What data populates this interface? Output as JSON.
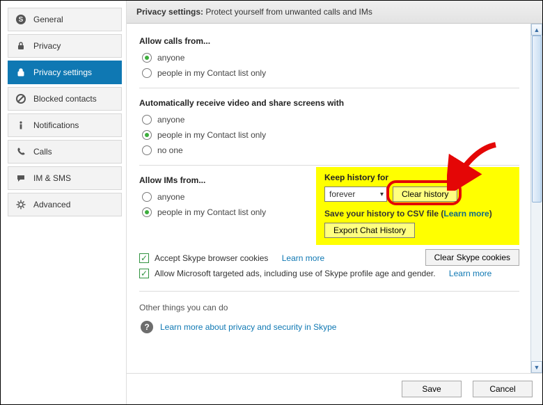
{
  "header": {
    "title_bold": "Privacy settings:",
    "title_rest": "Protect yourself from unwanted calls and IMs"
  },
  "sidebar": {
    "items": [
      {
        "label": "General"
      },
      {
        "label": "Privacy"
      },
      {
        "label": "Privacy settings"
      },
      {
        "label": "Blocked contacts"
      },
      {
        "label": "Notifications"
      },
      {
        "label": "Calls"
      },
      {
        "label": "IM & SMS"
      },
      {
        "label": "Advanced"
      }
    ]
  },
  "sections": {
    "calls": {
      "title": "Allow calls from...",
      "options": [
        "anyone",
        "people in my Contact list only"
      ],
      "selected": 0
    },
    "video": {
      "title": "Automatically receive video and share screens with",
      "options": [
        "anyone",
        "people in my Contact list only",
        "no one"
      ],
      "selected": 1
    },
    "ims": {
      "title": "Allow IMs from...",
      "options": [
        "anyone",
        "people in my Contact list only"
      ],
      "selected": 1
    }
  },
  "history": {
    "keep_title": "Keep history for",
    "select_value": "forever",
    "clear_btn": "Clear history",
    "save_text": "Save your history to CSV file (",
    "learn_more": "Learn more",
    "save_text_end": ")",
    "export_btn": "Export Chat History"
  },
  "checkboxes": {
    "cookies_text": "Accept Skype browser cookies",
    "cookies_learn": "Learn more",
    "ads_text": "Allow Microsoft targeted ads, including use of Skype profile age and gender.",
    "ads_learn": "Learn more"
  },
  "cookies_btn": "Clear Skype cookies",
  "other": {
    "title": "Other things you can do",
    "link": "Learn more about privacy and security in Skype"
  },
  "footer": {
    "save": "Save",
    "cancel": "Cancel"
  }
}
